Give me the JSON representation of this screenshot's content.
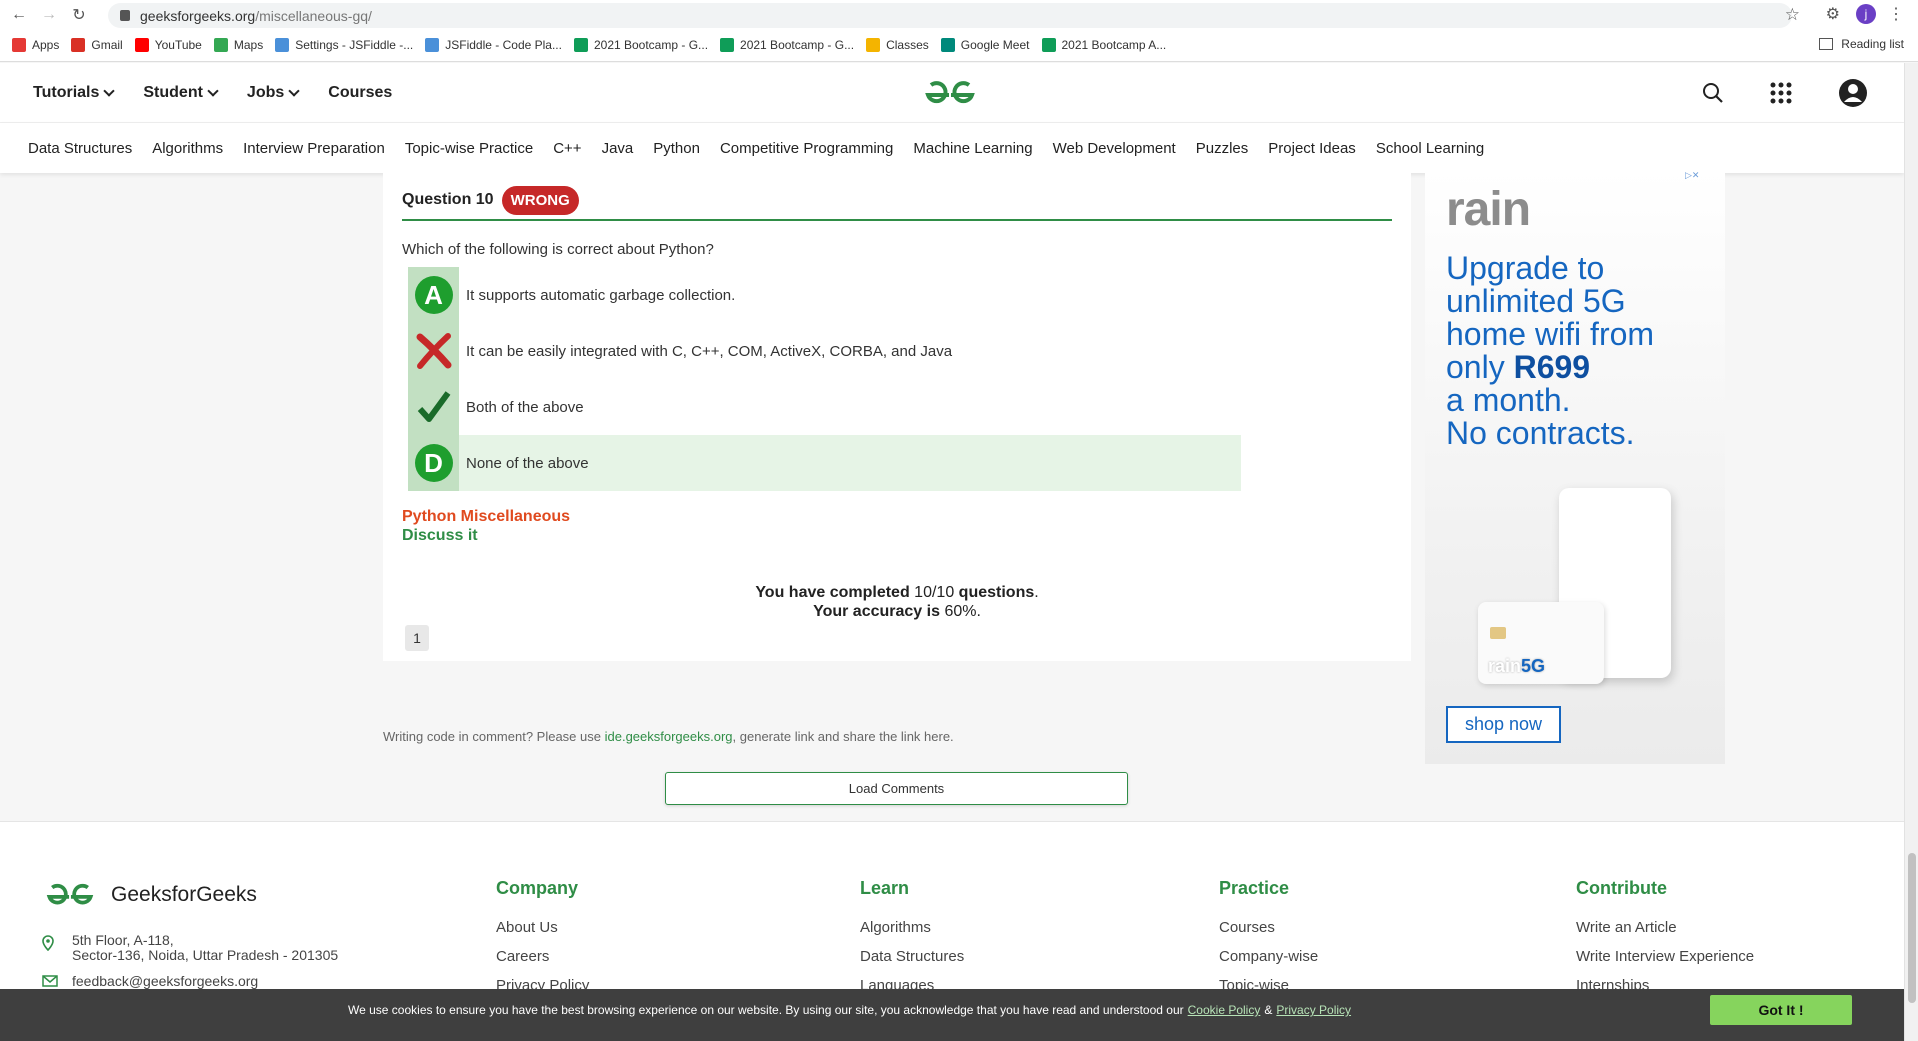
{
  "browser": {
    "url_domain": "geeksforgeeks.org",
    "url_path": "/miscellaneous-gq/",
    "profile_initial": "j",
    "bookmarks": [
      {
        "label": "Apps",
        "color": "#e53935"
      },
      {
        "label": "Gmail",
        "color": "#d93025"
      },
      {
        "label": "YouTube",
        "color": "#ff0000"
      },
      {
        "label": "Maps",
        "color": "#34a853"
      },
      {
        "label": "Settings - JSFiddle -...",
        "color": "#4a90d9"
      },
      {
        "label": "JSFiddle - Code Pla...",
        "color": "#4a90d9"
      },
      {
        "label": "2021 Bootcamp - G...",
        "color": "#0f9d58"
      },
      {
        "label": "2021 Bootcamp - G...",
        "color": "#0f9d58"
      },
      {
        "label": "Classes",
        "color": "#f4b400"
      },
      {
        "label": "Google Meet",
        "color": "#00897b"
      },
      {
        "label": "2021 Bootcamp A...",
        "color": "#0f9d58"
      }
    ],
    "reading_list": "Reading list"
  },
  "header": {
    "nav": [
      {
        "label": "Tutorials",
        "has_menu": true
      },
      {
        "label": "Student",
        "has_menu": true
      },
      {
        "label": "Jobs",
        "has_menu": true
      },
      {
        "label": "Courses",
        "has_menu": false
      }
    ],
    "subnav": [
      "Data Structures",
      "Algorithms",
      "Interview Preparation",
      "Topic-wise Practice",
      "C++",
      "Java",
      "Python",
      "Competitive Programming",
      "Machine Learning",
      "Web Development",
      "Puzzles",
      "Project Ideas",
      "School Learning"
    ]
  },
  "question": {
    "title": "Question 10",
    "status": "WRONG",
    "text": "Which of the following is correct about Python?",
    "options": [
      {
        "marker": "A",
        "label": "It supports automatic garbage collection."
      },
      {
        "marker": "wrong",
        "label": "It can be easily integrated with C, C++, COM, ActiveX, CORBA, and Java"
      },
      {
        "marker": "correct",
        "label": "Both of the above"
      },
      {
        "marker": "D",
        "label": "None of the above"
      }
    ],
    "tag": "Python Miscellaneous",
    "discuss": "Discuss it"
  },
  "result": {
    "line1_a": "You have completed",
    "line1_b": "10/10",
    "line1_c": "questions",
    "line2_a": "Your accuracy is",
    "line2_b": "60%."
  },
  "pagination": {
    "page": "1"
  },
  "comments": {
    "note_a": "Writing code in comment? Please use",
    "note_link": "ide.geeksforgeeks.org",
    "note_b": ", generate link and share the link here.",
    "load_label": "Load Comments"
  },
  "ad": {
    "brand": "rain",
    "line1": "Upgrade to",
    "line2": "unlimited 5G",
    "line3": "home wifi from",
    "line4_a": "only",
    "line4_b": "R699",
    "line5": "a month.",
    "line6": "No contracts.",
    "card_brand": "rain",
    "card_5g": "5G",
    "cta": "shop now"
  },
  "footer": {
    "brand": "GeeksforGeeks",
    "address_1": "5th Floor, A-118,",
    "address_2": "Sector-136, Noida, Uttar Pradesh - 201305",
    "email": "feedback@geeksforgeeks.org",
    "columns": [
      {
        "title": "Company",
        "links": [
          "About Us",
          "Careers",
          "Privacy Policy"
        ]
      },
      {
        "title": "Learn",
        "links": [
          "Algorithms",
          "Data Structures",
          "Languages"
        ]
      },
      {
        "title": "Practice",
        "links": [
          "Courses",
          "Company-wise",
          "Topic-wise"
        ]
      },
      {
        "title": "Contribute",
        "links": [
          "Write an Article",
          "Write Interview Experience",
          "Internships"
        ]
      }
    ]
  },
  "cookie": {
    "text": "We use cookies to ensure you have the best browsing experience on our website. By using our site, you acknowledge that you have read and understood our",
    "cookie_policy": "Cookie Policy",
    "amp": "&",
    "privacy_policy": "Privacy Policy",
    "button": "Got It !"
  },
  "colors": {
    "brand_green": "#2f8d46",
    "wrong_red": "#c62828",
    "ad_blue": "#1566c0",
    "cookie_button": "#86d45d"
  }
}
